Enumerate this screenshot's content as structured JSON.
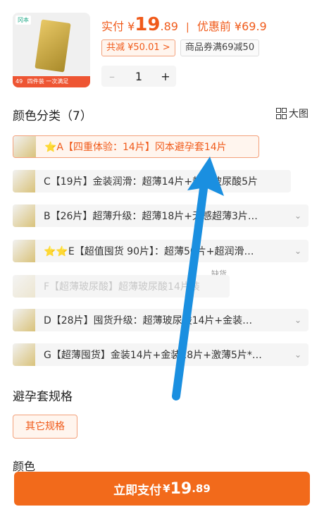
{
  "product": {
    "brand_label": "冈本",
    "thumb_bottom_left": "49",
    "thumb_bottom_text": "四件装 一次满足",
    "pay_prefix": "实付",
    "currency": "¥",
    "price_int": "19",
    "price_dec": ".89",
    "divider": "|",
    "original_price": "优惠前 ¥69.9",
    "discount_tag": "共减 ¥50.01 >",
    "coupon_tag": "商品券满69减50",
    "quantity": "1",
    "minus": "–",
    "plus": "+"
  },
  "color_section": {
    "title": "颜色分类（7）",
    "view_label": "大图",
    "options": [
      {
        "label": "⭐A【四重体验：14片】冈本避孕套14片",
        "state": "selected"
      },
      {
        "label": "C【19片】金装润滑：超薄14片+超薄玻尿酸5片",
        "state": "normal"
      },
      {
        "label": "B【26片】超薄升级：超薄18片+无感超薄3片…",
        "state": "normal"
      },
      {
        "label": "⭐⭐E【超值囤货 90片】：超薄50片+超润滑…",
        "state": "normal"
      },
      {
        "label": "F【超薄玻尿酸】超薄玻尿酸14片装",
        "state": "disabled"
      },
      {
        "label": "D【28片】囤货升级：超薄玻尿酸14片+金装…",
        "state": "normal"
      },
      {
        "label": "G【超薄囤货】金装14片+金装18片+激薄5片*…",
        "state": "normal"
      }
    ],
    "soldout_label": "缺货",
    "chevron": "⌄"
  },
  "spec_section": {
    "title": "避孕套规格",
    "option": "其它规格"
  },
  "cut_section": {
    "title": "颜色"
  },
  "pay_button": {
    "label": "立即支付",
    "currency": "¥",
    "amount_int": "19",
    "amount_dec": ".89"
  },
  "colors": {
    "accent": "#f05a1a",
    "pay_bg": "#f26a1b",
    "arrow": "#1a8fe0"
  }
}
